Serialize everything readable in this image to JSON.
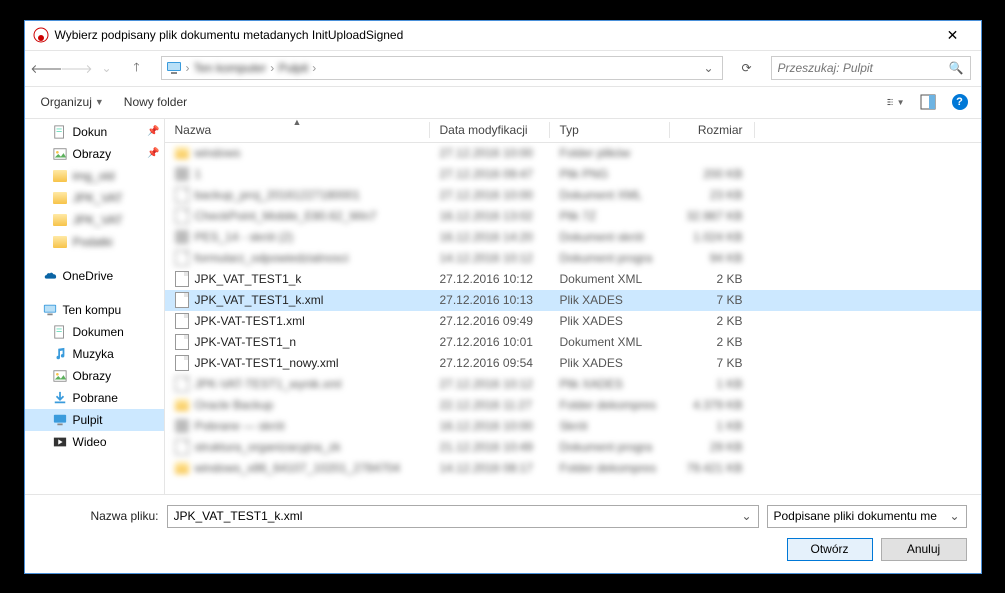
{
  "title": "Wybierz podpisany plik dokumentu metadanych InitUploadSigned",
  "breadcrumbs": [
    "Ten komputer",
    "Pulpit"
  ],
  "search_placeholder": "Przeszukaj: Pulpit",
  "toolbar": {
    "organize": "Organizuj",
    "new_folder": "Nowy folder"
  },
  "columns": {
    "name": "Nazwa",
    "date": "Data modyfikacji",
    "type": "Typ",
    "size": "Rozmiar"
  },
  "sidebar": {
    "quick": [
      {
        "label": "Dokun",
        "pin": true,
        "icon": "doc"
      },
      {
        "label": "Obrazy",
        "pin": true,
        "icon": "pic"
      },
      {
        "label": "img_old",
        "blur": true,
        "icon": "folder"
      },
      {
        "label": "JPK_VAT",
        "blur": true,
        "icon": "folder"
      },
      {
        "label": "JPK_VAT",
        "blur": true,
        "icon": "folder"
      },
      {
        "label": "Podatki",
        "blur": true,
        "icon": "folder"
      }
    ],
    "onedrive": "OneDrive",
    "thispc": "Ten kompu",
    "thispc_children": [
      {
        "label": "Dokumen",
        "icon": "doc"
      },
      {
        "label": "Muzyka",
        "icon": "music"
      },
      {
        "label": "Obrazy",
        "icon": "pic"
      },
      {
        "label": "Pobrane",
        "icon": "download"
      },
      {
        "label": "Pulpit",
        "icon": "desktop",
        "selected": true
      },
      {
        "label": "Wideo",
        "icon": "video"
      }
    ]
  },
  "files": [
    {
      "name": "windows",
      "date": "27.12.2016 10:00",
      "type": "Folder plików",
      "size": "",
      "blurred": true,
      "icon": "folder"
    },
    {
      "name": "1",
      "date": "27.12.2016 09:47",
      "type": "Plik PNG",
      "size": "200 KB",
      "blurred": true,
      "icon": "generic"
    },
    {
      "name": "backup_proj_20161227180001",
      "date": "27.12.2016 10:00",
      "type": "Dokument XML",
      "size": "23 KB",
      "blurred": true,
      "icon": "file"
    },
    {
      "name": "CheckPoint_Mobile_E80.62_Win7",
      "date": "16.12.2016 13:02",
      "type": "Plik 7Z",
      "size": "32.987 KB",
      "blurred": true,
      "icon": "file"
    },
    {
      "name": "PES_14 - skrót (2)",
      "date": "16.12.2016 14:20",
      "type": "Dokument skrót",
      "size": "1.024 KB",
      "blurred": true,
      "icon": "generic"
    },
    {
      "name": "formularz_odpowiedzialnosci",
      "date": "14.12.2016 10:12",
      "type": "Dokument progra",
      "size": "94 KB",
      "blurred": true,
      "icon": "file"
    },
    {
      "name": "JPK_VAT_TEST1_k",
      "date": "27.12.2016 10:12",
      "type": "Dokument XML",
      "size": "2 KB",
      "icon": "file"
    },
    {
      "name": "JPK_VAT_TEST1_k.xml",
      "date": "27.12.2016 10:13",
      "type": "Plik XADES",
      "size": "7 KB",
      "icon": "file",
      "selected": true
    },
    {
      "name": "JPK-VAT-TEST1.xml",
      "date": "27.12.2016 09:49",
      "type": "Plik XADES",
      "size": "2 KB",
      "icon": "file"
    },
    {
      "name": "JPK-VAT-TEST1_n",
      "date": "27.12.2016 10:01",
      "type": "Dokument XML",
      "size": "2 KB",
      "icon": "file"
    },
    {
      "name": "JPK-VAT-TEST1_nowy.xml",
      "date": "27.12.2016 09:54",
      "type": "Plik XADES",
      "size": "7 KB",
      "icon": "file"
    },
    {
      "name": "JPK-VAT-TEST1_wynik.xml",
      "date": "27.12.2016 10:12",
      "type": "Plik XADES",
      "size": "1 KB",
      "blurred": true,
      "icon": "file"
    },
    {
      "name": "Oracle Backup",
      "date": "22.12.2016 11:27",
      "type": "Folder dekompres",
      "size": "4.379 KB",
      "blurred": true,
      "icon": "folder"
    },
    {
      "name": "Pobrane — skrót",
      "date": "16.12.2016 10:00",
      "type": "Skrót",
      "size": "1 KB",
      "blurred": true,
      "icon": "generic"
    },
    {
      "name": "struktura_organizacyjna_zk",
      "date": "21.12.2016 10:49",
      "type": "Dokument progra",
      "size": "29 KB",
      "blurred": true,
      "icon": "file"
    },
    {
      "name": "windows_x86_64107_10201_2784704",
      "date": "14.12.2016 08:17",
      "type": "Folder dekompres",
      "size": "79.421 KB",
      "blurred": true,
      "icon": "folder"
    }
  ],
  "footer": {
    "filename_label": "Nazwa pliku:",
    "filename_value": "JPK_VAT_TEST1_k.xml",
    "filter": "Podpisane pliki dokumentu me",
    "open": "Otwórz",
    "cancel": "Anuluj"
  }
}
